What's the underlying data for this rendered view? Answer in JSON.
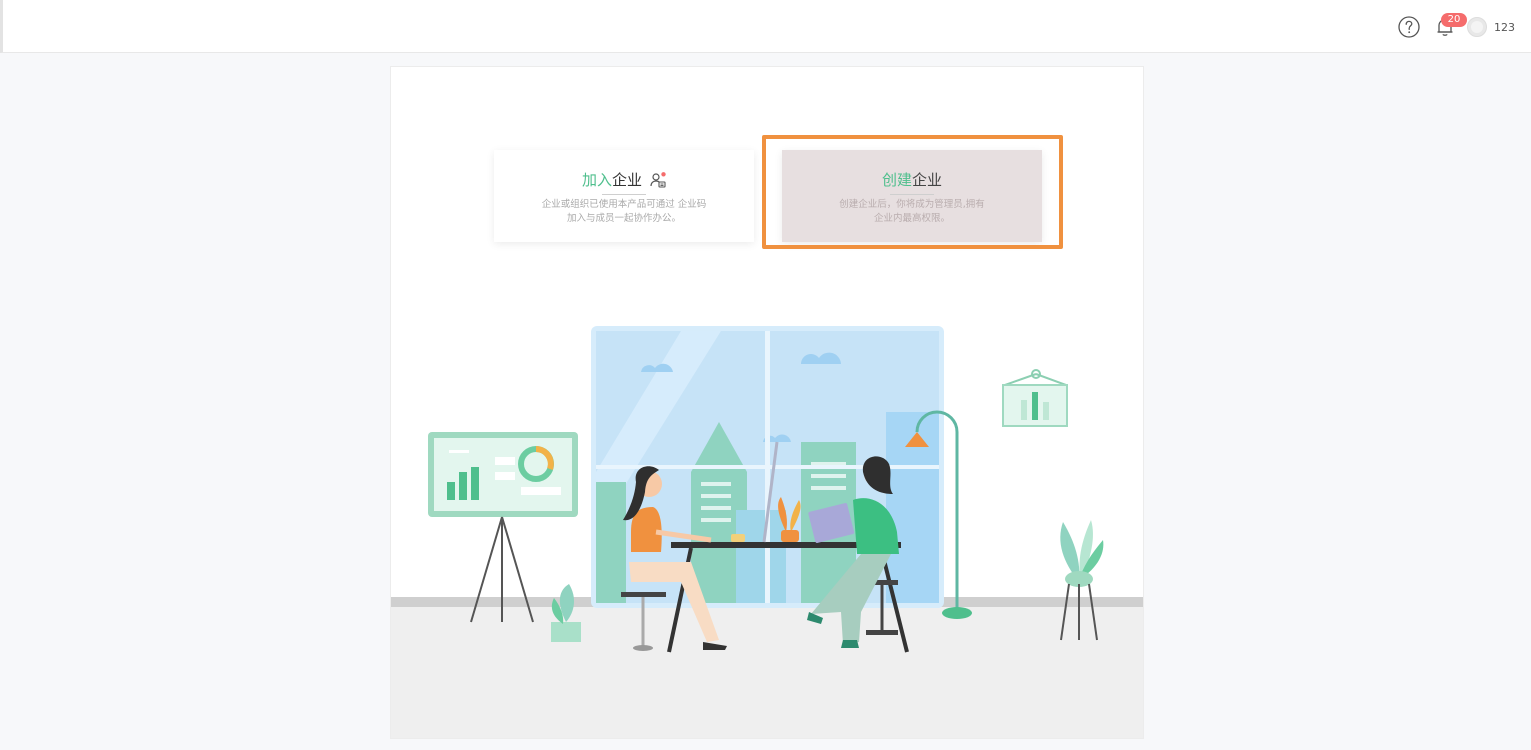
{
  "header": {
    "help_icon": "question-circle-icon",
    "notifications": {
      "icon": "bell-icon",
      "badge": "20"
    },
    "user": {
      "name": "123",
      "avatar_icon": "avatar-icon"
    }
  },
  "cards": {
    "join": {
      "title_accent": "加入",
      "title_rest": "企业",
      "icon": "user-card-icon",
      "desc_line1": "企业或组织已使用本产品可通过 企业码",
      "desc_line2": "加入与成员一起协作办公。"
    },
    "create": {
      "title_accent": "创建",
      "title_rest": "企业",
      "desc_line1": "创建企业后，你将成为管理员,拥有",
      "desc_line2": "企业内最高权限。"
    }
  },
  "colors": {
    "accent": "#4fbf8d",
    "highlight_outline": "#f0913f",
    "badge": "#f56c6c"
  }
}
